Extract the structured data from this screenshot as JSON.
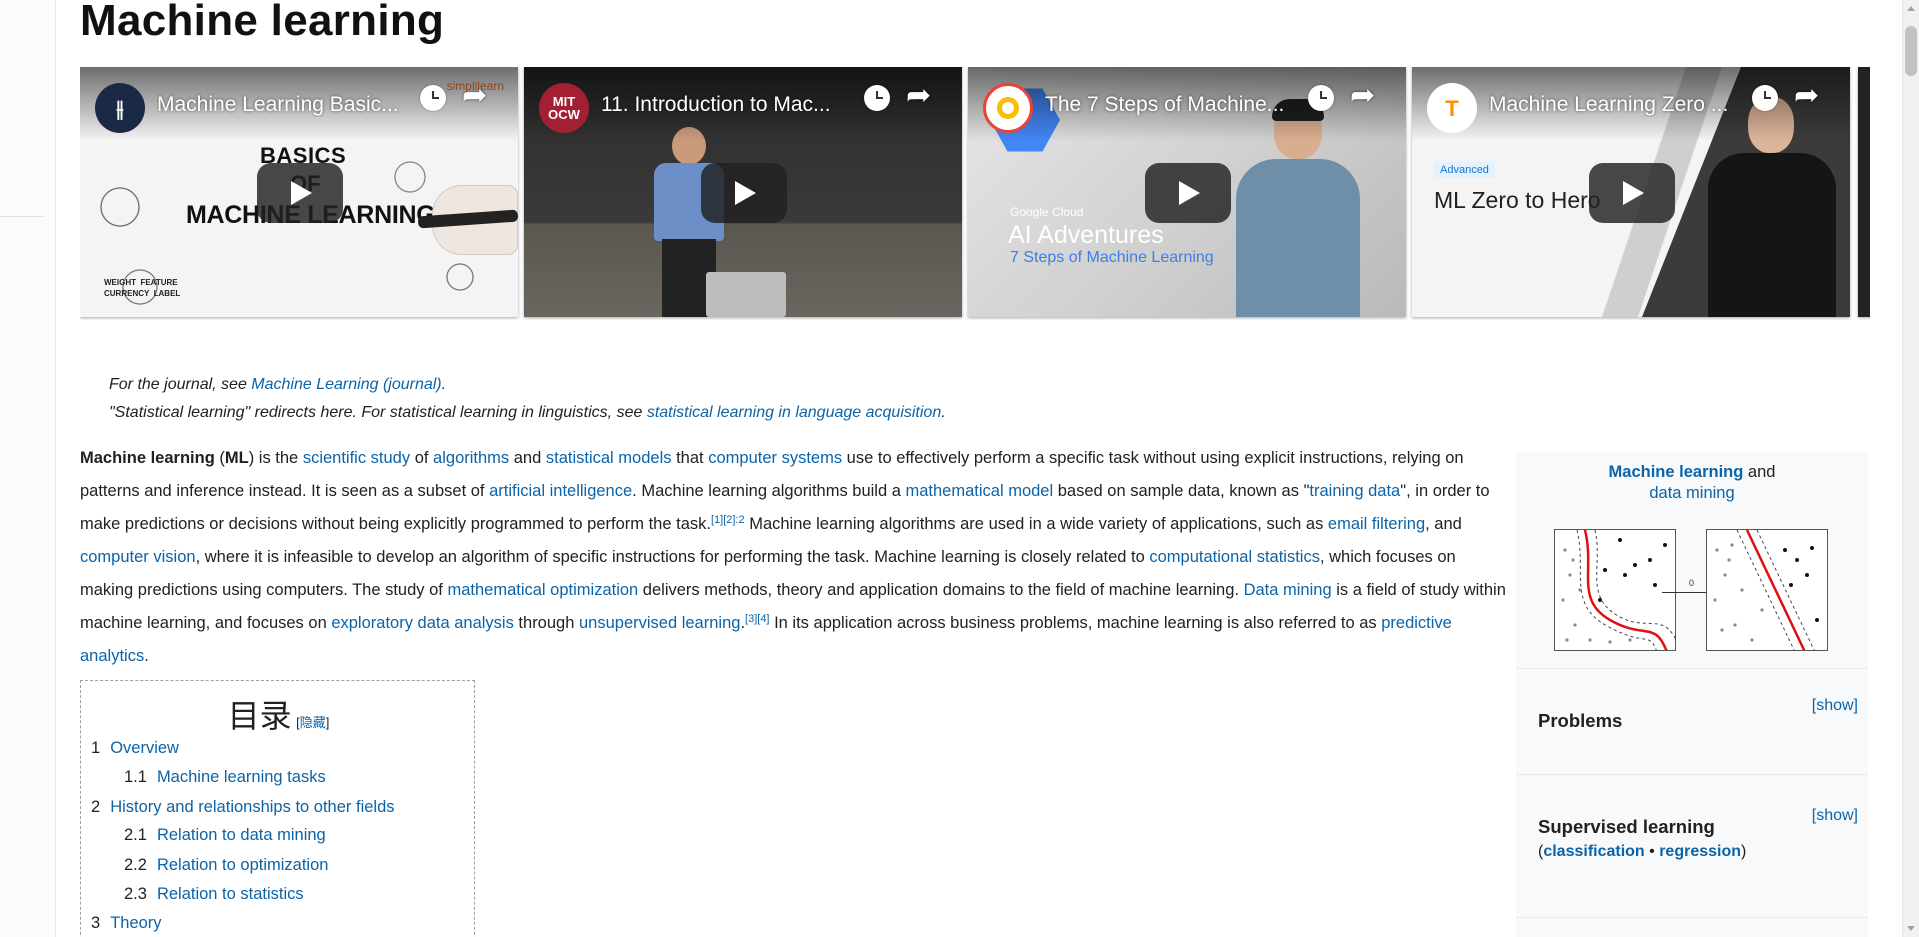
{
  "page": {
    "title": "Machine learning"
  },
  "videos": [
    {
      "title": "Machine Learning Basic...",
      "channel_badge": "",
      "brand": "simplilearn",
      "overlay": [
        "BASICS",
        "OF",
        "MACHINE LEARNING"
      ],
      "labels": "WEIGHT  FEATURE\nCURRENCY  LABEL"
    },
    {
      "title": "11. Introduction to Mac...",
      "channel_badge": "MIT\nOCW"
    },
    {
      "title": "The 7 Steps of Machine...",
      "overlay": [
        "Google Cloud",
        "AI Adventures",
        "7 Steps of  Machine Learning"
      ]
    },
    {
      "title": "Machine Learning Zero ...",
      "overlay": [
        "Advanced",
        "ML Zero to Hero"
      ]
    }
  ],
  "hatnotes": [
    {
      "prefix": "For the journal, see ",
      "link": "Machine Learning (journal)",
      "suffix": "."
    },
    {
      "prefix": "\"Statistical learning\" redirects here. For statistical learning in linguistics, see ",
      "link": "statistical learning in language acquisition",
      "suffix": "."
    }
  ],
  "lead": {
    "t0": "Machine learning",
    "t1": " (",
    "t2": "ML",
    "t3": ") is the ",
    "l1": "scientific study",
    "t4": " of ",
    "l2": "algorithms",
    "t5": " and ",
    "l3": "statistical models",
    "t6": " that ",
    "l4": "computer systems",
    "t7": " use to effectively perform a specific task without using explicit instructions, relying on patterns and inference instead. It is seen as a subset of ",
    "l5": "artificial intelligence",
    "t8": ". Machine learning algorithms build a ",
    "l6": "mathematical model",
    "t9": " based on sample data, known as \"",
    "l7": "training data",
    "t10": "\", in order to make predictions or decisions without being explicitly programmed to perform the task.",
    "r1": "[1][2]:2",
    "t11": " Machine learning algorithms are used in a wide variety of applications, such as ",
    "l8": "email filtering",
    "t12": ", and ",
    "l9": "computer vision",
    "t13": ", where it is infeasible to develop an algorithm of specific instructions for performing the task. Machine learning is closely related to ",
    "l10": "computational statistics",
    "t14": ", which focuses on making predictions using computers. The study of ",
    "l11": "mathematical optimization",
    "t15": " delivers methods, theory and application domains to the field of machine learning. ",
    "l12": "Data mining",
    "t16": " is a field of study within machine learning, and focuses on ",
    "l13": "exploratory data analysis",
    "t17": " through ",
    "l14": "unsupervised learning",
    "t18": ".",
    "r2": "[3][4]",
    "t19": " In its application across business problems, machine learning is also referred to as ",
    "l15": "predictive analytics",
    "t20": "."
  },
  "toc": {
    "title": "目录",
    "toggle_open": "[",
    "toggle": "隐藏",
    "toggle_close": "]",
    "items": [
      {
        "num": "1",
        "label": "Overview"
      },
      {
        "num": "1.1",
        "label": "Machine learning tasks"
      },
      {
        "num": "2",
        "label": "History and relationships to other fields"
      },
      {
        "num": "2.1",
        "label": "Relation to data mining"
      },
      {
        "num": "2.2",
        "label": "Relation to optimization"
      },
      {
        "num": "2.3",
        "label": "Relation to statistics"
      },
      {
        "num": "3",
        "label": "Theory"
      }
    ]
  },
  "infobox": {
    "top_link1": "Machine learning",
    "top_and": " and",
    "top_link2": "data mining",
    "plot_label": "0",
    "sections": [
      {
        "title": "Problems",
        "show": "[show]"
      },
      {
        "title": "Supervised learning",
        "show": "[show]",
        "sub_open": "(",
        "sub_link1": "classification",
        "sub_sep": " • ",
        "sub_link2": "regression",
        "sub_close": ")"
      }
    ]
  },
  "colors": {
    "link": "#0b63a8",
    "text": "#202122",
    "infobox_bg": "#f8f9fa"
  }
}
